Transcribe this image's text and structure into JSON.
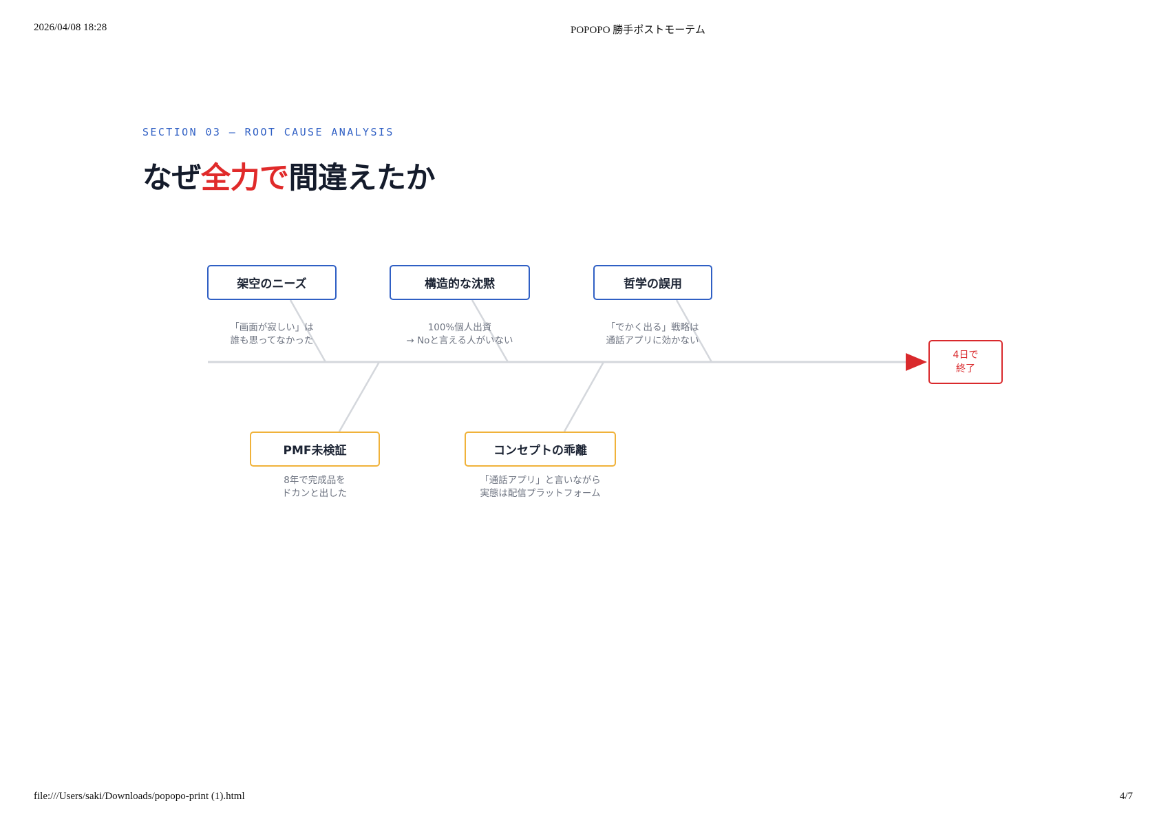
{
  "print_header": {
    "datetime": "2026/04/08 18:28",
    "doc_title": "POPOPO 勝手ポストモーテム"
  },
  "print_footer": {
    "file_path": "file:///Users/saki/Downloads/popopo-print (1).html",
    "page": "4/7"
  },
  "section_label": "SECTION 03 — ROOT CAUSE ANALYSIS",
  "title": {
    "part1": "なぜ",
    "accent": "全力で",
    "part2": "間違えたか"
  },
  "colors": {
    "blue": "#2f5fc4",
    "orange": "#f0b23a",
    "red": "#d9292c",
    "spine": "#d4d7dc",
    "text_dark": "#1b2333",
    "text_muted": "#6d7380"
  },
  "fishbone": {
    "causes_top": [
      {
        "label": "架空のニーズ",
        "note": [
          "「画面が寂しい」は",
          "誰も思ってなかった"
        ]
      },
      {
        "label": "構造的な沈黙",
        "note": [
          "100%個人出資",
          "→ Noと言える人がいない"
        ]
      },
      {
        "label": "哲学の誤用",
        "note": [
          "「でかく出る」戦略は",
          "通話アプリに効かない"
        ]
      }
    ],
    "causes_bottom": [
      {
        "label": "PMF未検証",
        "note": [
          "8年で完成品を",
          "ドカンと出した"
        ]
      },
      {
        "label": "コンセプトの乖離",
        "note": [
          "「通話アプリ」と言いながら",
          "実態は配信プラットフォーム"
        ]
      }
    ],
    "effect": {
      "lines": [
        "4日で",
        "終了"
      ]
    }
  }
}
